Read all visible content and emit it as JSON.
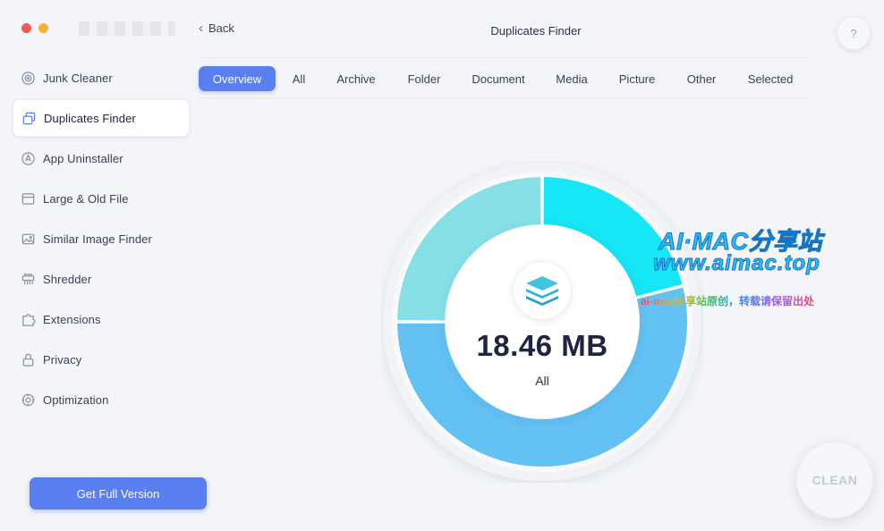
{
  "window": {
    "title": "Duplicates Finder",
    "back_label": "Back",
    "help_label": "?"
  },
  "sidebar": {
    "items": [
      {
        "label": "Junk Cleaner",
        "icon": "junk-cleaner-icon"
      },
      {
        "label": "Duplicates Finder",
        "icon": "duplicates-icon",
        "active": true
      },
      {
        "label": "App Uninstaller",
        "icon": "app-uninstaller-icon"
      },
      {
        "label": "Large & Old File",
        "icon": "large-file-icon"
      },
      {
        "label": "Similar Image Finder",
        "icon": "similar-image-icon"
      },
      {
        "label": "Shredder",
        "icon": "shredder-icon"
      },
      {
        "label": "Extensions",
        "icon": "extensions-icon"
      },
      {
        "label": "Privacy",
        "icon": "privacy-lock-icon"
      },
      {
        "label": "Optimization",
        "icon": "optimization-icon"
      }
    ],
    "full_version_label": "Get Full Version"
  },
  "tabs": [
    {
      "label": "Overview",
      "active": true
    },
    {
      "label": "All"
    },
    {
      "label": "Archive"
    },
    {
      "label": "Folder"
    },
    {
      "label": "Document"
    },
    {
      "label": "Media"
    },
    {
      "label": "Picture"
    },
    {
      "label": "Other"
    },
    {
      "label": "Selected"
    }
  ],
  "summary": {
    "size": "18.46 MB",
    "category": "All",
    "icon": "layers-stack-icon",
    "segments": [
      {
        "fraction": 0.21,
        "color": "#16e6f5"
      },
      {
        "fraction": 0.54,
        "color": "#64c1f4"
      },
      {
        "fraction": 0.25,
        "color": "#86e0e6"
      }
    ]
  },
  "clean_label": "CLEAN",
  "watermark": {
    "line1": "AI·MAC分享站",
    "line2": "www.aimac.top",
    "line3": "ai-mac分享站原创，转载请保留出处"
  },
  "colors": {
    "accent": "#5a7ff0",
    "background": "#f4f5f9"
  }
}
